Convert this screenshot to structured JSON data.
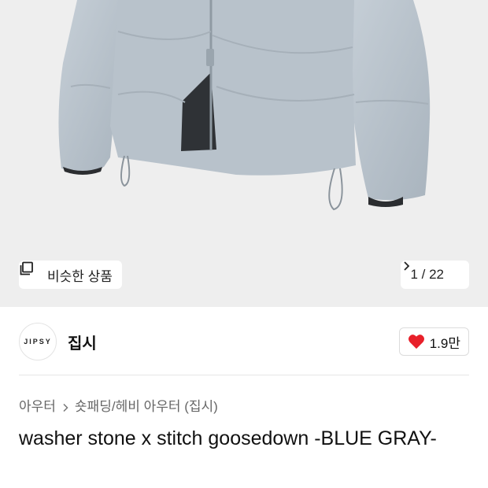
{
  "hero": {
    "image_alt": "light blue-gray down jacket",
    "similar_label": "비슷한 상품",
    "pager": {
      "current": "1",
      "total": "22",
      "text": "1 / 22"
    }
  },
  "brand": {
    "logo_text": "JIPSY",
    "name": "집시",
    "like_count": "1.9만",
    "heart_color": "#e8202a"
  },
  "breadcrumb": {
    "items": [
      "아우터",
      "숏패딩/헤비 아우터 (집시)"
    ]
  },
  "product": {
    "title": "washer stone x stitch goosedown -BLUE GRAY-"
  },
  "colors": {
    "hero_bg": "#eeeeee",
    "jacket": "#b9c3cc"
  }
}
